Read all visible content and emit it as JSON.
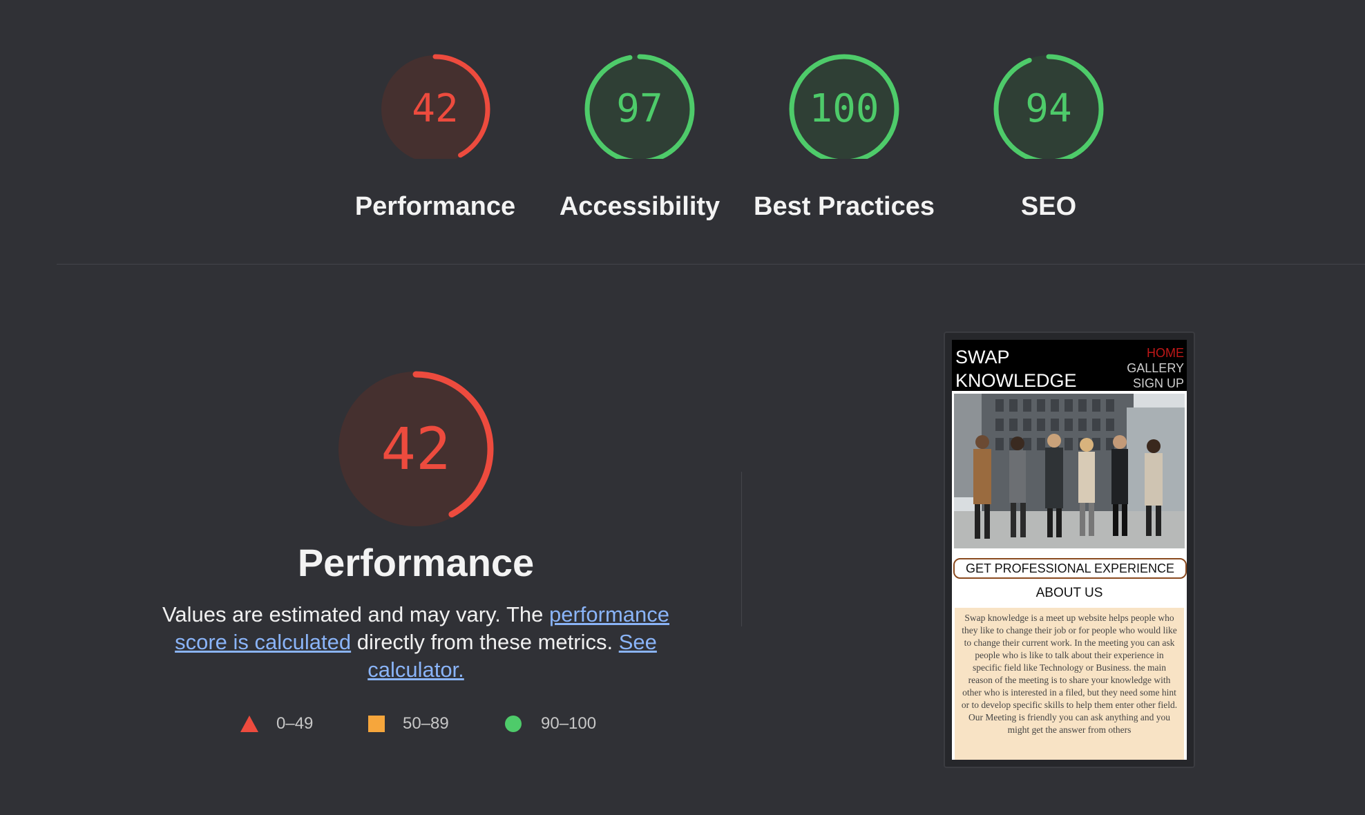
{
  "scores": [
    {
      "label": "Performance",
      "value": "42",
      "score": 42,
      "color": "#ed4b3e",
      "bg": "#45302f"
    },
    {
      "label": "Accessibility",
      "value": "97",
      "score": 97,
      "color": "#4ecb6a",
      "bg": "#2f3f35"
    },
    {
      "label": "Best Practices",
      "value": "100",
      "score": 100,
      "color": "#4ecb6a",
      "bg": "#2f3f35"
    },
    {
      "label": "SEO",
      "value": "94",
      "score": 94,
      "color": "#4ecb6a",
      "bg": "#2f3f35"
    }
  ],
  "performance": {
    "score": "42",
    "title": "Performance",
    "desc_prefix": "Values are estimated and may vary. The ",
    "link1": "performance score is calculated",
    "desc_middle": " directly from these metrics. ",
    "link2": "See calculator."
  },
  "legend": [
    {
      "icon": "triangle",
      "range": "0–49",
      "color": "#ed4b3e"
    },
    {
      "icon": "square",
      "range": "50–89",
      "color": "#f6a63c"
    },
    {
      "icon": "circle",
      "range": "90–100",
      "color": "#4ecb6a"
    }
  ],
  "screenshot": {
    "brand_line1": "SWAP",
    "brand_line2": "KNOWLEDGE",
    "nav": [
      "HOME",
      "GALLERY",
      "SIGN UP"
    ],
    "cta": "GET PROFESSIONAL EXPERIENCE",
    "about_title": "ABOUT US",
    "about_text": "Swap knowledge is a meet up website helps people who they like to change their job or for people who would like to change their current work. In the meeting you can ask people who is like to talk about their experience in specific field like Technology or Business. the main reason of the meeting is to share your knowledge with other who is interested in a filed, but they need some hint or to develop specific skills to help them enter other field. Our Meeting is friendly you can ask anything and you might get the answer from others"
  }
}
